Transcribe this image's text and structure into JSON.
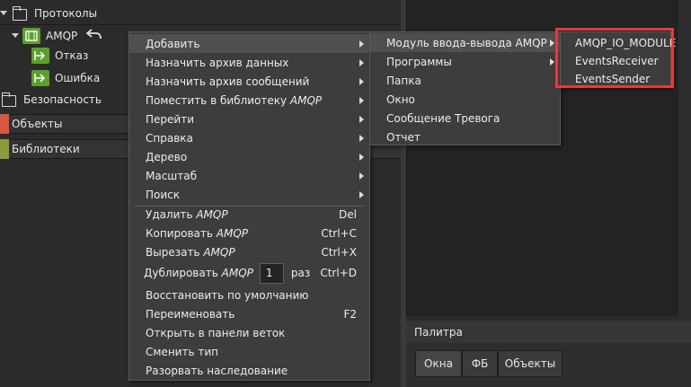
{
  "tree": {
    "protocols_label": "Протоколы",
    "amqp_label": "AMQP",
    "otkaz_label": "Отказ",
    "oshibka_label": "Ошибка",
    "security_label": "Безопасность"
  },
  "panels": {
    "objects_label": "Объекты",
    "libraries_label": "Библиотеки",
    "objects_color": "#d9573c",
    "libraries_color": "#8f9a3a"
  },
  "palette": {
    "title": "Палитра",
    "tabs": [
      {
        "label": "Окна"
      },
      {
        "label": "ФБ"
      },
      {
        "label": "Объекты"
      }
    ]
  },
  "context_menu": {
    "items": [
      {
        "label": "Добавить"
      },
      {
        "label": "Назначить архив данных"
      },
      {
        "label": "Назначить архив сообщений"
      },
      {
        "label": "Поместить в библиотеку",
        "italic": "AMQP"
      },
      {
        "label": "Перейти"
      },
      {
        "label": "Справка"
      },
      {
        "label": "Дерево"
      },
      {
        "label": "Масштаб"
      },
      {
        "label": "Поиск"
      }
    ],
    "edit_items": [
      {
        "label": "Удалить",
        "italic": "AMQP",
        "shortcut": "Del"
      },
      {
        "label": "Копировать",
        "italic": "AMQP",
        "shortcut": "Ctrl+C"
      },
      {
        "label": "Вырезать",
        "italic": "AMQP",
        "shortcut": "Ctrl+X"
      }
    ],
    "duplicate": {
      "label": "Дублировать",
      "italic": "AMQP",
      "count": "1",
      "suffix": "раз",
      "shortcut": "Ctrl+D"
    },
    "tail_items": [
      {
        "label": "Восстановить по умолчанию"
      },
      {
        "label": "Переименовать",
        "shortcut": "F2"
      },
      {
        "label": "Открыть в панели веток"
      },
      {
        "label": "Сменить тип"
      },
      {
        "label": "Разорвать наследование"
      }
    ]
  },
  "submenu_add": {
    "items": [
      {
        "label": "Модуль ввода-вывода AMQP"
      },
      {
        "label": "Программы"
      },
      {
        "label": "Папка"
      },
      {
        "label": "Окно"
      },
      {
        "label": "Сообщение Тревога"
      },
      {
        "label": "Отчет"
      }
    ]
  },
  "submenu_io": {
    "items": [
      {
        "label": "AMQP_IO_MODULE"
      },
      {
        "label": "EventsReceiver"
      },
      {
        "label": "EventsSender"
      }
    ]
  },
  "colors": {
    "highlight_frame": "#e8393c",
    "module_green": "#5aa02c"
  }
}
